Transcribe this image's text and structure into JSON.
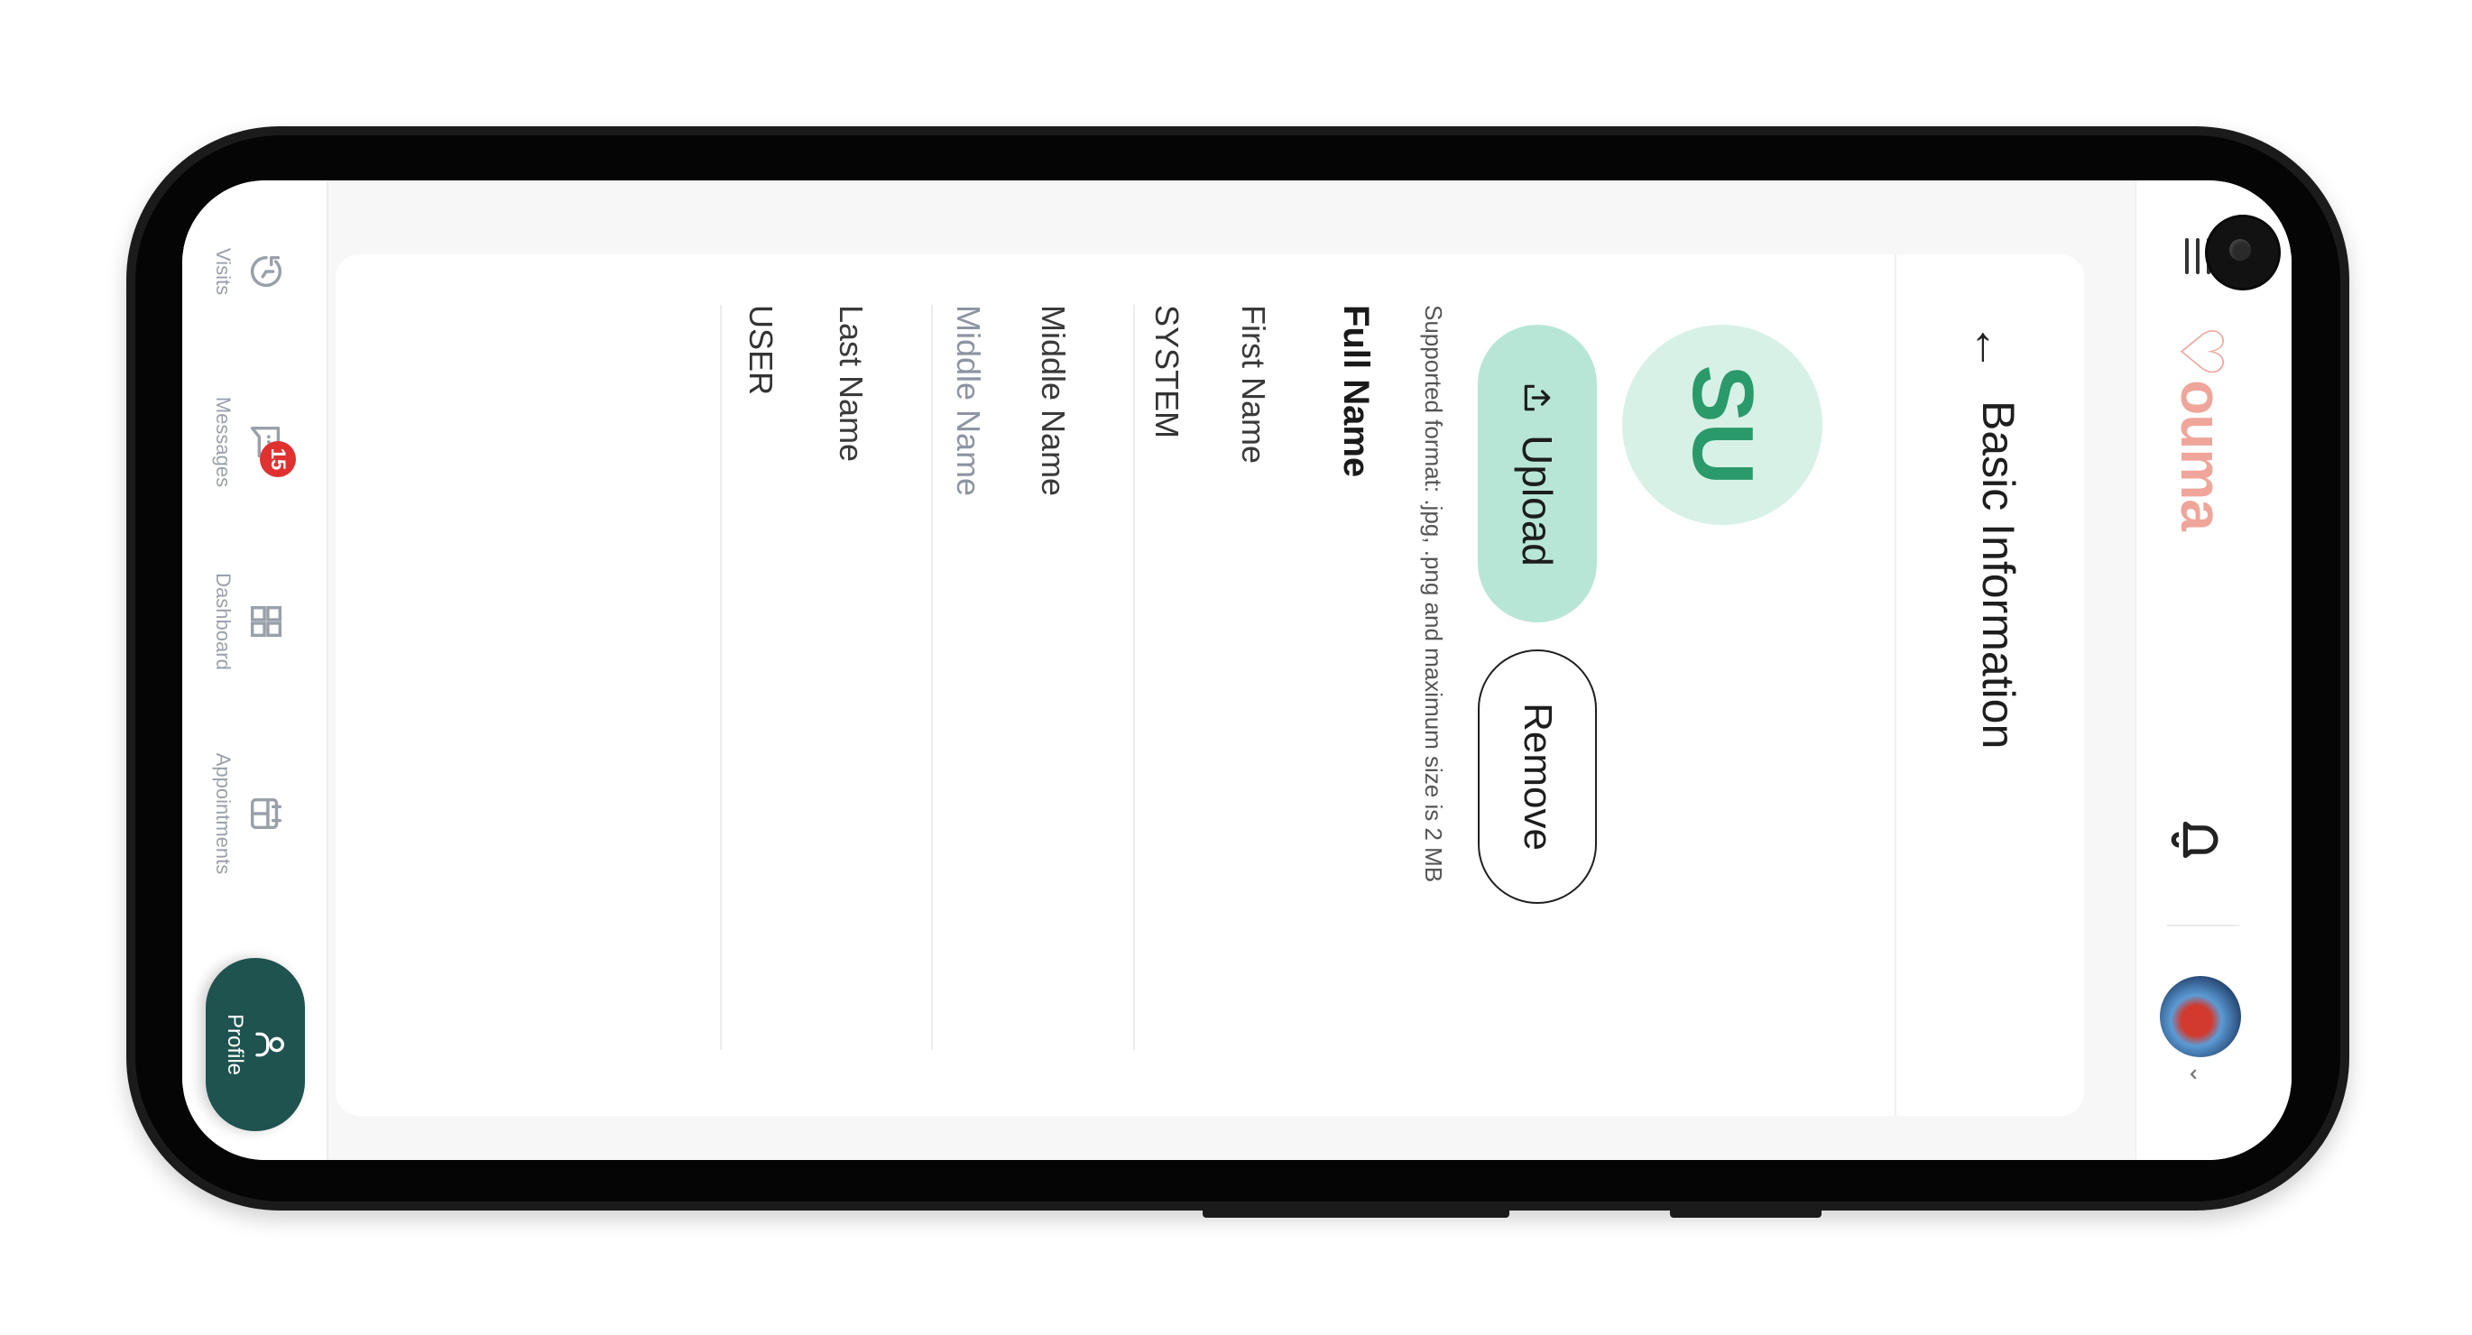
{
  "app": {
    "brand": "ouma",
    "colors": {
      "brand": "#f0a59a",
      "accent": "#b8e6d6",
      "initials_bg": "#d7f1e6",
      "initials_text": "#2a9a6a",
      "nav_active": "#1f5350",
      "badge": "#e03131"
    },
    "icons": {
      "menu": "menu-icon",
      "bell": "bell-icon",
      "back": "arrow-left-icon",
      "upload": "upload-icon",
      "visits": "history-icon",
      "messages": "chat-icon",
      "dashboard": "grid-icon",
      "appointments": "calendar-icon",
      "profile": "user-icon"
    }
  },
  "page": {
    "back_arrow": "←",
    "title": "Basic Information"
  },
  "profile_photo": {
    "initials": "SU",
    "upload_label": "Upload",
    "remove_label": "Remove",
    "hint": "Supported format: .jpg, .png and maximum size is 2 MB"
  },
  "full_name": {
    "section_title": "Full Name",
    "first_name_label": "First Name",
    "first_name_value": "SYSTEM",
    "middle_name_label": "Middle Name",
    "middle_name_placeholder": "Middle Name",
    "last_name_label": "Last Name",
    "last_name_value": "USER"
  },
  "bottom_nav": {
    "items": [
      {
        "label": "Visits"
      },
      {
        "label": "Messages",
        "badge": "15"
      },
      {
        "label": "Dashboard"
      },
      {
        "label": "Appointments"
      },
      {
        "label": "Profile",
        "active": true
      }
    ]
  }
}
